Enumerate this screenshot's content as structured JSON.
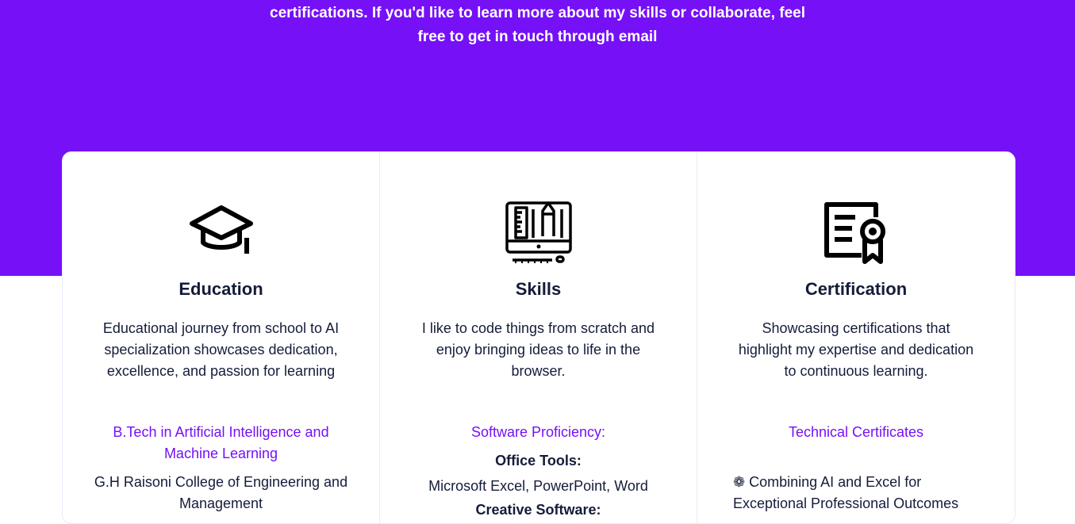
{
  "hero": {
    "text": "certifications. If you'd like to learn more about my skills or collaborate, feel free to get in touch through email"
  },
  "colors": {
    "accent": "#7510f7",
    "text": "#141c3a",
    "border": "#e6ecf8"
  },
  "cards": [
    {
      "icon": "graduation-cap-icon",
      "title": "Education",
      "description": "Educational journey from school to AI specialization showcases dedication, excellence, and passion for learning",
      "subtitle": "B.Tech in Artificial Intelligence and Machine Learning",
      "detail": "G.H Raisoni College of Engineering and Management"
    },
    {
      "icon": "design-monitor-icon",
      "title": "Skills",
      "description": "I like to code things from scratch and enjoy bringing ideas to life in the browser.",
      "subtitle": "Software Proficiency:",
      "group1_label": "Office Tools:",
      "group1_items": "Microsoft Excel, PowerPoint, Word",
      "group2_label": "Creative Software:"
    },
    {
      "icon": "certificate-icon",
      "title": "Certification",
      "description": "Showcasing certifications that highlight my expertise and dedication to continuous learning.",
      "subtitle": "Technical Certificates",
      "item1": "❁ Combining AI and Excel for Exceptional Professional Outcomes"
    }
  ]
}
